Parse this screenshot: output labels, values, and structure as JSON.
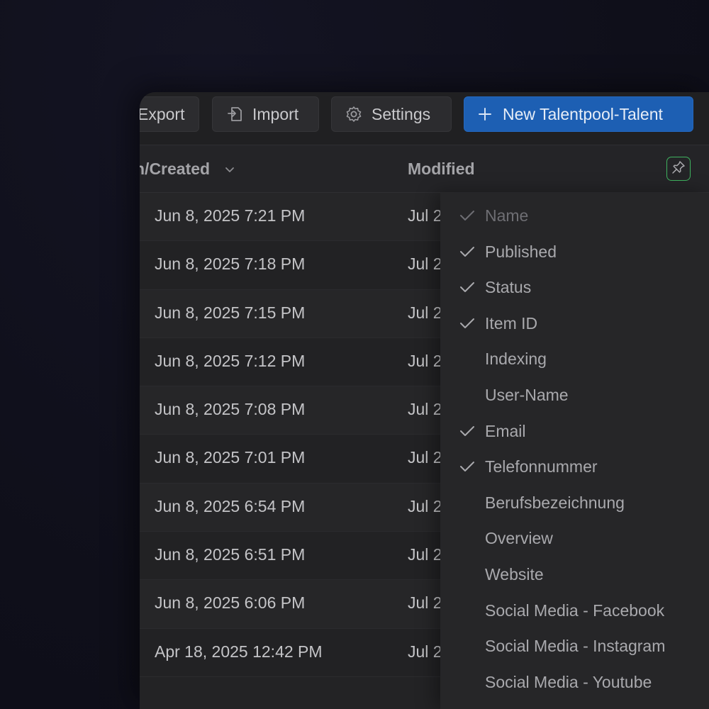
{
  "toolbar": {
    "export_label": "Export",
    "import_label": "Import",
    "settings_label": "Settings",
    "new_label": "New Talentpool-Talent",
    "primary_color": "#1d5fb3"
  },
  "table": {
    "columns": {
      "created": "n/Created",
      "modified": "Modified"
    },
    "rows": [
      {
        "created": "Jun 8, 2025 7:21 PM",
        "modified": "Jul 2"
      },
      {
        "created": "Jun 8, 2025 7:18 PM",
        "modified": "Jul 2"
      },
      {
        "created": "Jun 8, 2025 7:15 PM",
        "modified": "Jul 2"
      },
      {
        "created": "Jun 8, 2025 7:12 PM",
        "modified": "Jul 2"
      },
      {
        "created": "Jun 8, 2025 7:08 PM",
        "modified": "Jul 2"
      },
      {
        "created": "Jun 8, 2025 7:01 PM",
        "modified": "Jul 2"
      },
      {
        "created": "Jun 8, 2025 6:54 PM",
        "modified": "Jul 2"
      },
      {
        "created": "Jun 8, 2025 6:51 PM",
        "modified": "Jul 2"
      },
      {
        "created": "Jun 8, 2025 6:06 PM",
        "modified": "Jul 2"
      },
      {
        "created": "Apr 18, 2025 12:42 PM",
        "modified": "Jul 2"
      }
    ]
  },
  "column_menu": {
    "pin_icon": "pin-icon",
    "accent_color": "#3fb35f",
    "options": [
      {
        "label": "Name",
        "checked": true,
        "disabled": true
      },
      {
        "label": "Published",
        "checked": true,
        "disabled": false
      },
      {
        "label": "Status",
        "checked": true,
        "disabled": false
      },
      {
        "label": "Item ID",
        "checked": true,
        "disabled": false
      },
      {
        "label": "Indexing",
        "checked": false,
        "disabled": false
      },
      {
        "label": "User-Name",
        "checked": false,
        "disabled": false
      },
      {
        "label": "Email",
        "checked": true,
        "disabled": false
      },
      {
        "label": "Telefonnummer",
        "checked": true,
        "disabled": false
      },
      {
        "label": "Berufsbezeichnung",
        "checked": false,
        "disabled": false
      },
      {
        "label": "Overview",
        "checked": false,
        "disabled": false
      },
      {
        "label": "Website",
        "checked": false,
        "disabled": false
      },
      {
        "label": "Social Media - Facebook",
        "checked": false,
        "disabled": false
      },
      {
        "label": "Social Media - Instagram",
        "checked": false,
        "disabled": false
      },
      {
        "label": "Social Media - Youtube",
        "checked": false,
        "disabled": false
      }
    ]
  }
}
